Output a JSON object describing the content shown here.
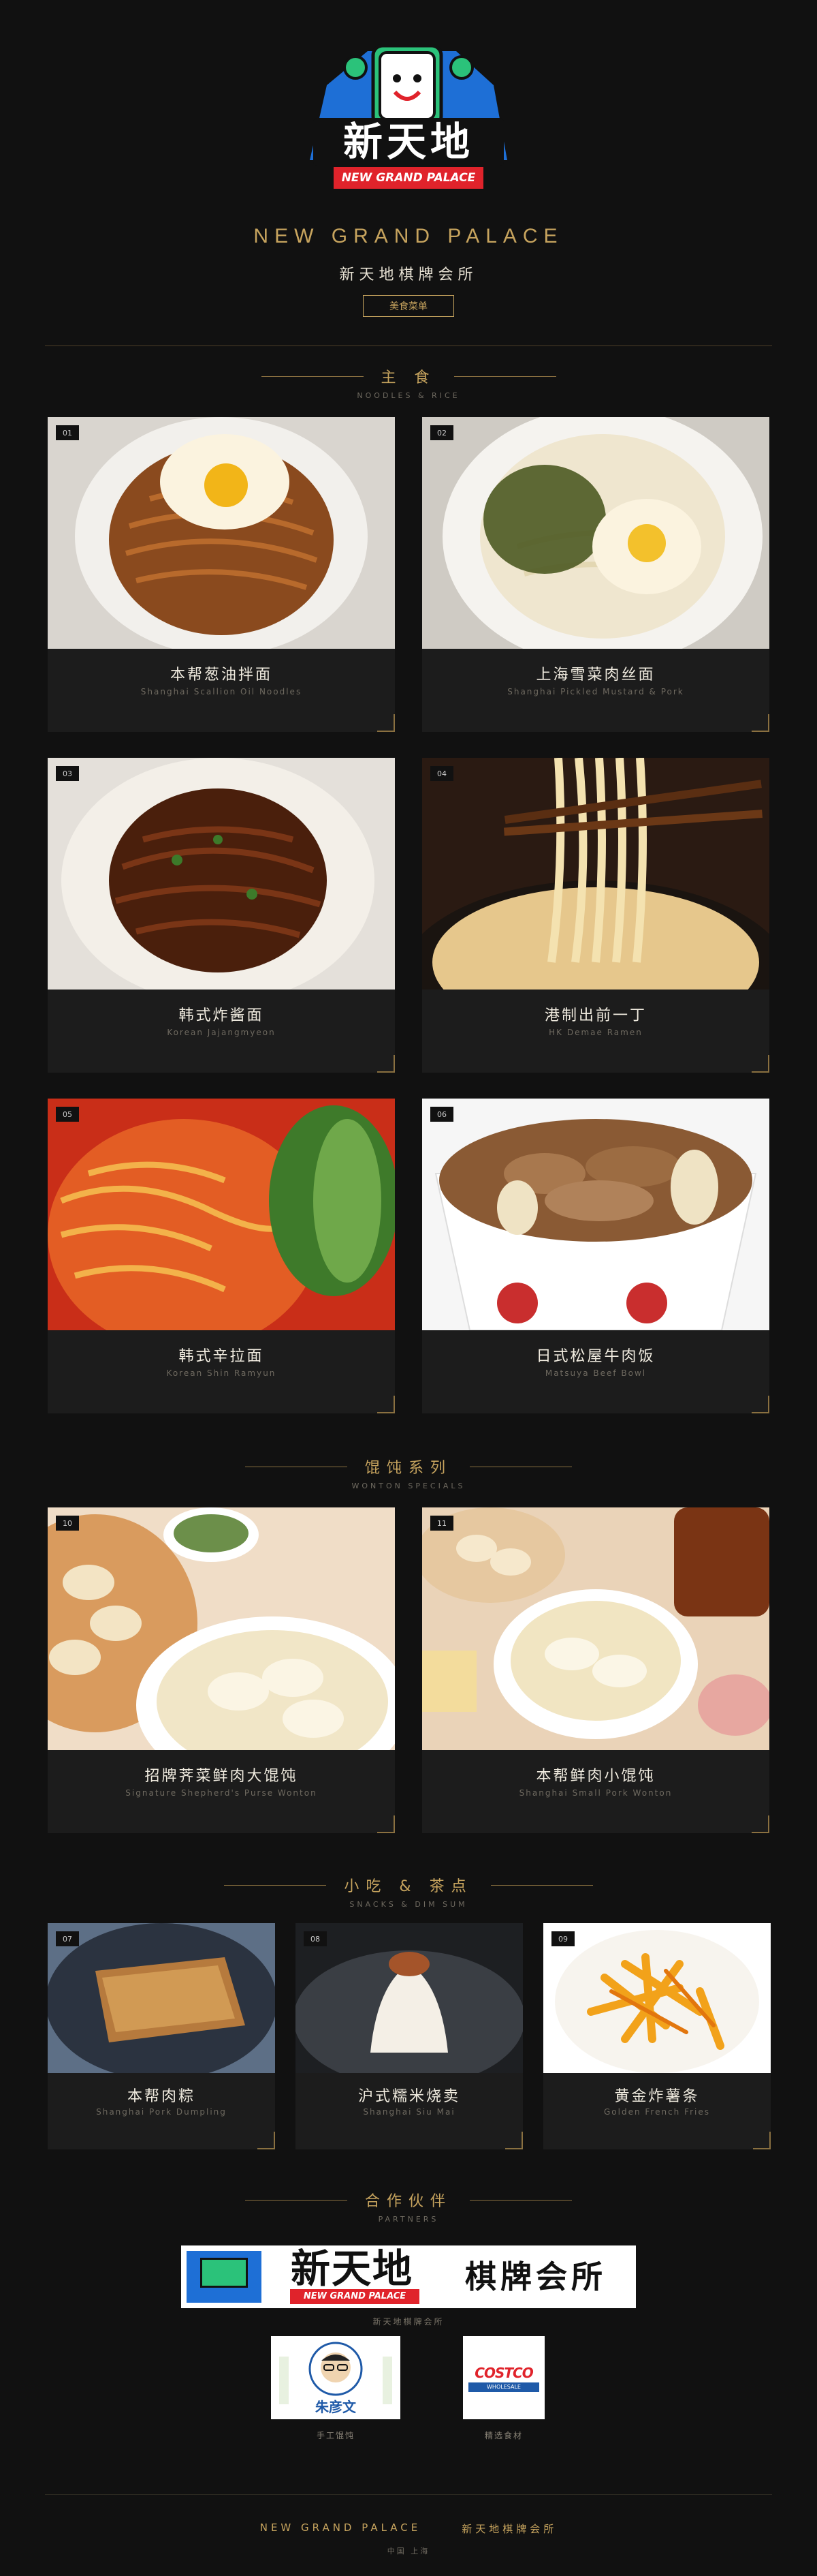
{
  "header": {
    "logo_text_zh": "新天地",
    "logo_text_en": "NEW GRAND PALACE",
    "brand_en": "NEW GRAND PALACE",
    "brand_zh": "新天地棋牌会所",
    "menu_button": "美食菜单"
  },
  "sections": {
    "noodles": {
      "title": "主 食",
      "subtitle": "NOODLES & RICE"
    },
    "wonton": {
      "title": "馄饨系列",
      "subtitle": "WONTON SPECIALS"
    },
    "snacks": {
      "title": "小吃 & 茶点",
      "subtitle": "SNACKS & DIM SUM"
    },
    "partners": {
      "title": "合作伙伴",
      "subtitle": "PARTNERS"
    }
  },
  "noodles": [
    {
      "num": "01",
      "name": "本帮葱油拌面",
      "en": "Shanghai Scallion Oil Noodles"
    },
    {
      "num": "02",
      "name": "上海雪菜肉丝面",
      "en": "Shanghai Pickled Mustard & Pork"
    },
    {
      "num": "03",
      "name": "韩式炸酱面",
      "en": "Korean Jajangmyeon"
    },
    {
      "num": "04",
      "name": "港制出前一丁",
      "en": "HK Demae Ramen"
    },
    {
      "num": "05",
      "name": "韩式辛拉面",
      "en": "Korean Shin Ramyun"
    },
    {
      "num": "06",
      "name": "日式松屋牛肉饭",
      "en": "Matsuya Beef Bowl"
    }
  ],
  "wontons": [
    {
      "num": "10",
      "name": "招牌荠菜鲜肉大馄饨",
      "en": "Signature Shepherd's Purse Wonton"
    },
    {
      "num": "11",
      "name": "本帮鲜肉小馄饨",
      "en": "Shanghai Small Pork Wonton"
    }
  ],
  "snacks": [
    {
      "num": "07",
      "name": "本帮肉粽",
      "en": "Shanghai Pork Dumpling"
    },
    {
      "num": "08",
      "name": "沪式糯米烧卖",
      "en": "Shanghai Siu Mai"
    },
    {
      "num": "09",
      "name": "黄金炸薯条",
      "en": "Golden French Fries"
    }
  ],
  "partners": {
    "banner_zh": "新天地",
    "banner_suffix": "棋牌会所",
    "banner_en": "NEW GRAND PALACE",
    "tagline": "新天地棋牌会所",
    "logos": [
      {
        "name": "朱彦文",
        "label": "手工馄饨"
      },
      {
        "name": "COSTCO",
        "sub": "WHOLESALE",
        "label": "精选食材"
      }
    ]
  },
  "footer": {
    "left": "NEW GRAND PALACE",
    "right": "新天地棋牌会所",
    "sub": "中国 上海"
  },
  "colors": {
    "background": "#111111",
    "gold": "#c7a45e",
    "card": "#1c1c1c"
  }
}
